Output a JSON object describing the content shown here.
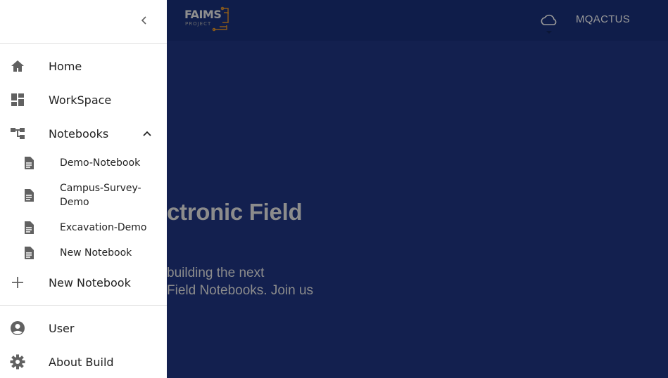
{
  "appbar": {
    "logo_word": "FAIMS",
    "logo_sub": "PROJECT",
    "cloud_icon": "cloud-icon",
    "user_label": "MQACTUS"
  },
  "hero": {
    "title_fragment": "ctronic Field",
    "text_line1": "building the next",
    "text_line2": "Field Notebooks. Join us"
  },
  "drawer": {
    "collapse_icon": "chevron-left-icon",
    "items": [
      {
        "label": "Home",
        "icon": "home-icon"
      },
      {
        "label": "WorkSpace",
        "icon": "dashboard-icon"
      },
      {
        "label": "Notebooks",
        "icon": "account-tree-icon",
        "expanded": true
      }
    ],
    "notebooks": [
      {
        "label": "Demo-Notebook",
        "icon": "document-icon"
      },
      {
        "label": "Campus-Survey-Demo",
        "icon": "document-icon"
      },
      {
        "label": "Excavation-Demo",
        "icon": "document-icon"
      },
      {
        "label": "New Notebook",
        "icon": "document-icon"
      }
    ],
    "new_notebook": {
      "label": "New Notebook",
      "icon": "plus-icon"
    },
    "footer_items": [
      {
        "label": "User",
        "icon": "account-circle-icon"
      },
      {
        "label": "About Build",
        "icon": "gear-icon"
      }
    ]
  },
  "colors": {
    "background": "#13204f",
    "appbar": "#0f1d4a",
    "drawer": "#ffffff",
    "icon": "#616161",
    "logo_accent": "#8a5a1a"
  }
}
